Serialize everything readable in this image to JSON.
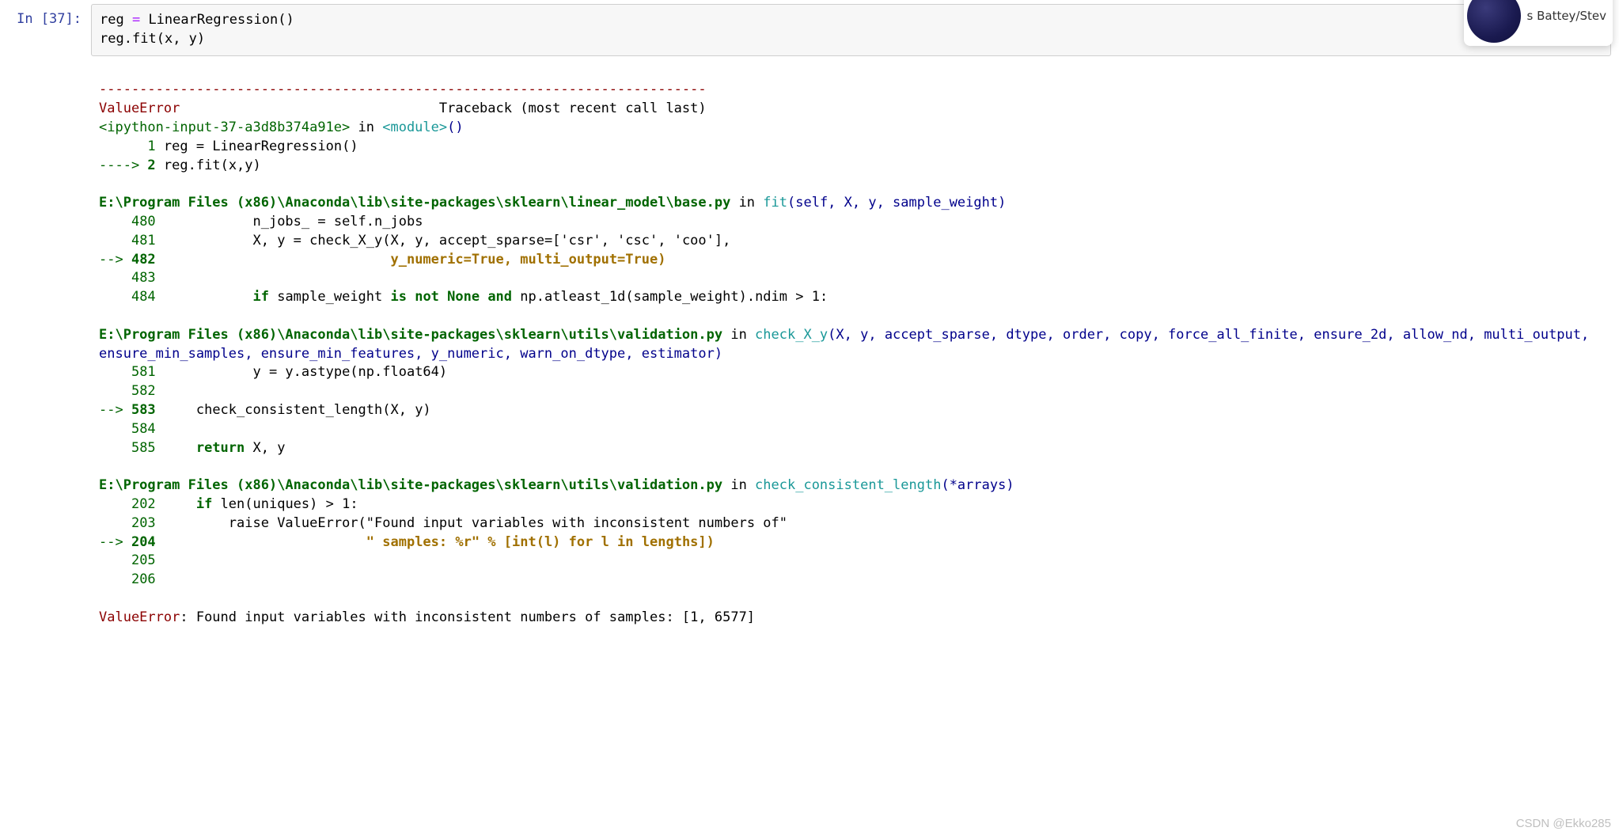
{
  "prompt": {
    "label": "In",
    "open": "[",
    "num": "37",
    "close": "]:",
    "full": "In  [37]:"
  },
  "code": {
    "line1_parts": [
      "reg ",
      "=",
      " LinearRegression",
      "()",
      ""
    ],
    "line2_parts": [
      "reg",
      ".",
      "fit",
      "(",
      "x",
      ",",
      " y",
      ")"
    ]
  },
  "trace": {
    "sep": "---------------------------------------------------------------------------",
    "err_name": "ValueError",
    "tb_label": "Traceback (most recent call last)",
    "ipy_loc": "<ipython-input-37-a3d8b374a91e>",
    "in_word": " in ",
    "module": "<module>",
    "module_paren": "()",
    "l1_lineno_prefix": "      1",
    "l1_code": " reg = LinearRegression",
    "l1_paren": "()",
    "l2_arrow": "----> ",
    "l2_num": "2",
    "l2_code_a": " reg.fit",
    "l2_paren_o": "(",
    "l2_args": "x,y",
    "l2_paren_c": ")",
    "f1_path": "E:\\Program Files (x86)\\Anaconda\\lib\\site-packages\\sklearn\\linear_model\\base.py",
    "f1_in": " in ",
    "f1_func": "fit",
    "f1_sig": "(self, X, y, sample_weight)",
    "f1_480": "    480            n_jobs_ = self.n_jobs",
    "f1_481": "    481            X, y = check_X_y(X, y, accept_sparse=['csr', 'csc', 'coo'],",
    "f1_482_arrow": "--> ",
    "f1_482_num": "482",
    "f1_482_code": "                             y_numeric=True, multi_output=True)",
    "f1_483": "    483 ",
    "f1_484_a": "    484            ",
    "f1_484_if": "if",
    "f1_484_b": " sample_weight ",
    "f1_484_isnot": "is not None and",
    "f1_484_c": " np.atleast_1d(sample_weight).ndim > 1:",
    "f2_path": "E:\\Program Files (x86)\\Anaconda\\lib\\site-packages\\sklearn\\utils\\validation.py",
    "f2_in": " in ",
    "f2_func": "check_X_y",
    "f2_sig": "(X, y, accept_sparse, dtype, order, copy, force_all_finite, ensure_2d, allow_nd, multi_output, ensure_min_samples, ensure_min_features, y_numeric, warn_on_dtype, estimator)",
    "f2_581": "    581            y = y.astype(np.float64)",
    "f2_582": "    582 ",
    "f2_583_arrow": "--> ",
    "f2_583_num": "583",
    "f2_583_code": "     check_consistent_length(X, y)",
    "f2_584": "    584 ",
    "f2_585_a": "    585     ",
    "f2_585_return": "return",
    "f2_585_b": " X, y",
    "f3_path": "E:\\Program Files (x86)\\Anaconda\\lib\\site-packages\\sklearn\\utils\\validation.py",
    "f3_in": " in ",
    "f3_func": "check_consistent_length",
    "f3_sig": "(*arrays)",
    "f3_202_a": "    202     ",
    "f3_202_if": "if",
    "f3_202_b": " len(uniques) > 1:",
    "f3_203": "    203         raise ValueError(\"Found input variables with inconsistent numbers of\"",
    "f3_204_arrow": "--> ",
    "f3_204_num": "204",
    "f3_204_code": "                          \" samples: %r\" % [int(l) for l in lengths])",
    "f3_205": "    205 ",
    "f3_206": "    206 ",
    "final_err": "ValueError",
    "final_msg": ": Found input variables with inconsistent numbers of samples: [1, 6577]"
  },
  "avatar": {
    "name": "s Battey/Stev"
  },
  "watermark": "CSDN @Ekko285"
}
